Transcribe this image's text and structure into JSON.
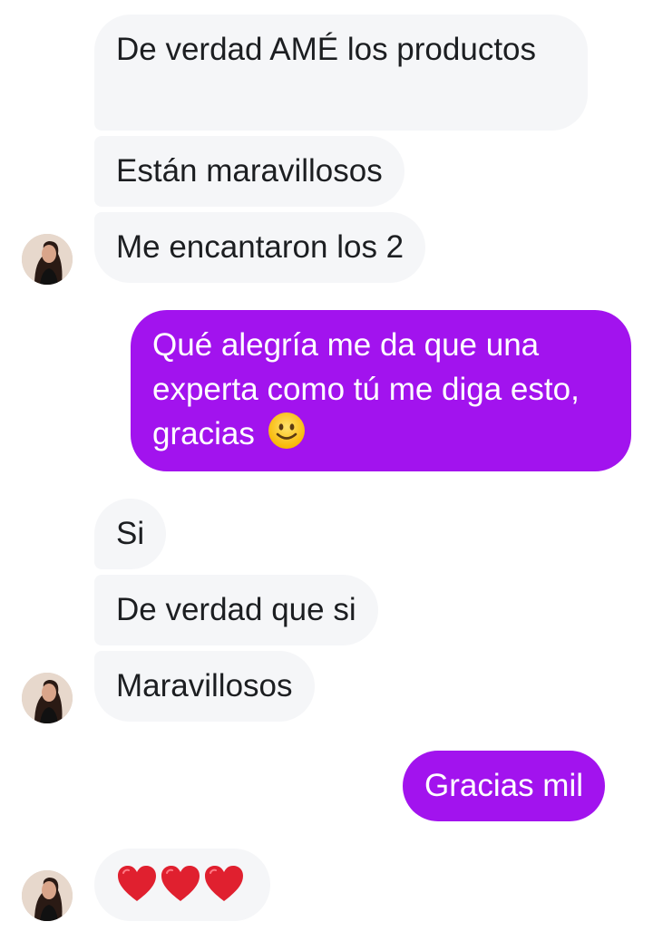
{
  "conversation": {
    "messages": [
      {
        "sender": "contact",
        "text": "De verdad AMÉ los productos"
      },
      {
        "sender": "contact",
        "text": "Están maravillosos"
      },
      {
        "sender": "contact",
        "text": "Me encantaron los 2"
      },
      {
        "sender": "me",
        "text": "Qué alegría me da que una experta como tú me diga esto, gracias",
        "emoji": "slightly-smiling-face"
      },
      {
        "sender": "contact",
        "text": "Si"
      },
      {
        "sender": "contact",
        "text": "De verdad que si"
      },
      {
        "sender": "contact",
        "text": "Maravillosos"
      },
      {
        "sender": "me",
        "text": "Gracias mil"
      },
      {
        "sender": "contact",
        "emoji": [
          "red-heart",
          "red-heart",
          "red-heart"
        ]
      }
    ]
  },
  "colors": {
    "incoming_bubble": "#f5f6f8",
    "outgoing_bubble": "#a213ee",
    "outgoing_text": "#ffffff",
    "incoming_text": "#1c1e21"
  }
}
